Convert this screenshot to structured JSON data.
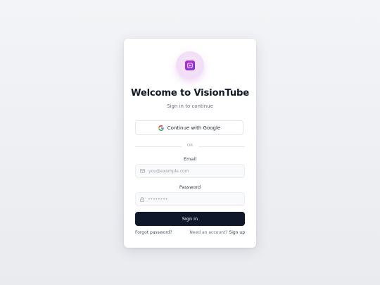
{
  "app": {
    "name": "VisionTube"
  },
  "login": {
    "title": "Welcome to VisionTube",
    "subtitle": "Sign in to continue",
    "google_button_label": "Continue with Google",
    "divider_text": "OR",
    "email_label": "Email",
    "email_placeholder": "you@example.com",
    "password_label": "Password",
    "password_placeholder": "••••••••",
    "signin_button_label": "Sign in",
    "forgot_password_label": "Forgot password?",
    "need_account_text": "Need an account?",
    "signup_label": "Sign up"
  },
  "icons": {
    "logo": "play-icon",
    "google": "google-icon",
    "email": "mail-icon",
    "password": "lock-icon"
  },
  "colors": {
    "accent_start": "#c026d3",
    "accent_end": "#7c3aed",
    "primary_button": "#0f172a"
  }
}
